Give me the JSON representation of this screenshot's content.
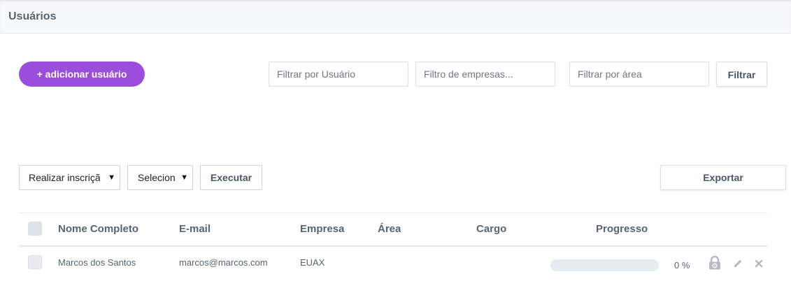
{
  "header": {
    "title": "Usuários"
  },
  "toolbar": {
    "add_user_label": "+ adicionar usuário",
    "filter_user_placeholder": "Filtrar por Usuário",
    "filter_company_placeholder": "Filtro de empresas...",
    "filter_area_placeholder": "Filtrar por área",
    "filter_button_label": "Filtrar"
  },
  "bulk_actions": {
    "action_select_value": "Realizar inscrição",
    "target_select_value": "Selecione",
    "execute_label": "Executar",
    "export_label": "Exportar"
  },
  "table": {
    "columns": [
      "Nome Completo",
      "E-mail",
      "Empresa",
      "Área",
      "Cargo",
      "Progresso"
    ],
    "rows": [
      {
        "name": "Marcos dos Santos",
        "email": "marcos@marcos.com",
        "company": "EUAX",
        "area": "",
        "role": "",
        "progress": 0,
        "progress_label": "0 %"
      }
    ]
  },
  "icons": {
    "lock": "lock-icon",
    "edit": "pencil-icon",
    "delete": "close-icon"
  },
  "colors": {
    "accent": "#9b4ddb",
    "progress_track": "#e6ebf1",
    "text": "#5a6275"
  }
}
